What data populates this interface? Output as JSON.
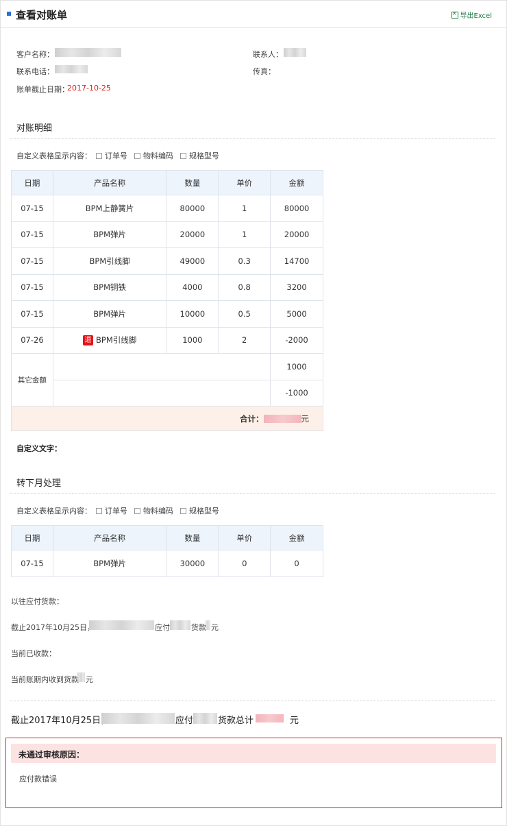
{
  "header": {
    "title": "查看对账单",
    "export_label": "导出Excel"
  },
  "info": {
    "customer_label": "客户名称：",
    "contact_label": "联系人：",
    "phone_label": "联系电话：",
    "fax_label": "传真：",
    "deadline_label": "账单截止日期：",
    "deadline_value": "2017-10-25"
  },
  "detail": {
    "title": "对账明细",
    "custom_label": "自定义表格显示内容：",
    "options": [
      "订单号",
      "物料编码",
      "规格型号"
    ],
    "columns": [
      "日期",
      "产品名称",
      "数量",
      "单价",
      "金额"
    ],
    "rows": [
      [
        "07-15",
        "BPM上静簧片",
        "80000",
        "1",
        "80000"
      ],
      [
        "07-15",
        "BPM弹片",
        "20000",
        "1",
        "20000"
      ],
      [
        "07-15",
        "BPM引线脚",
        "49000",
        "0.3",
        "14700"
      ],
      [
        "07-15",
        "BPM铜铁",
        "4000",
        "0.8",
        "3200"
      ],
      [
        "07-15",
        "BPM弹片",
        "10000",
        "0.5",
        "5000"
      ],
      [
        "07-26",
        "BPM引线脚",
        "1000",
        "2",
        "-2000"
      ]
    ],
    "return_badge": "退",
    "other_label": "其它金额",
    "other_values": [
      "1000",
      "-1000"
    ],
    "total_label": "合计：",
    "total_unit": "元",
    "custom_text_label": "自定义文字："
  },
  "next_month": {
    "title": "转下月处理",
    "custom_label": "自定义表格显示内容：",
    "options": [
      "订单号",
      "物料编码",
      "规格型号"
    ],
    "columns": [
      "日期",
      "产品名称",
      "数量",
      "单价",
      "金额"
    ],
    "rows": [
      [
        "07-15",
        "BPM弹片",
        "30000",
        "0",
        "0"
      ]
    ]
  },
  "payables": {
    "previous_label": "以往应付货款：",
    "line1_prefix": "截止2017年10月25日，",
    "line1_mid": "应付",
    "line1_mid2": "货款",
    "line1_unit": "元",
    "received_label": "当前已收款：",
    "received_line_prefix": "当前账期内收到货款",
    "received_line_unit": "元",
    "total_prefix": "截止2017年10月25日，",
    "total_mid": "应付",
    "total_mid2": "货款总计",
    "total_unit": "元"
  },
  "reject": {
    "title": "未通过审核原因：",
    "reason": "应付款错误"
  }
}
